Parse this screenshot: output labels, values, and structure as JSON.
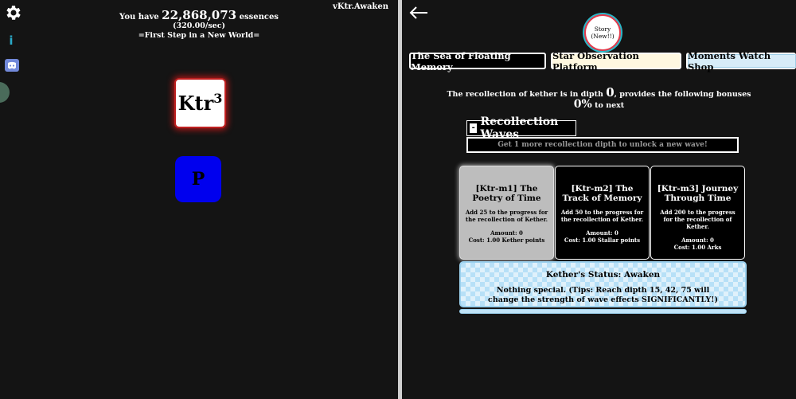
{
  "left": {
    "version": "vKtr.Awaken",
    "essence_prefix": "You have",
    "essence_amount": "22,868,073",
    "essence_suffix": "essences",
    "rate": "(320.00/sec)",
    "world": "=First Step in a New World=",
    "ktr_label": "Ktr",
    "ktr_exponent": "3",
    "p_label": "P",
    "info_glyph": "i",
    "icons": [
      "gear-icon",
      "info-icon",
      "discord-icon"
    ]
  },
  "right": {
    "back_glyph": "←",
    "story": {
      "line1": "Story",
      "line2": "(New!!)"
    },
    "tabs": [
      {
        "label": "The Sea of Floating Memory"
      },
      {
        "label": "Star Observation Platform"
      },
      {
        "label": "Moments Watch Shop"
      }
    ],
    "bonus": {
      "prefix": "The recollection of kether is in dipth",
      "depth": "0",
      "suffix": ", provides the following bonuses",
      "percent": "0%",
      "next": "to next"
    },
    "waves": {
      "collapse": "-",
      "title": "Recollection Waves",
      "unlock_hint": "Get 1 more recollection dipth to unlock a new wave!",
      "cards": [
        {
          "title": "[Ktr-m1] The Poetry of Time",
          "desc": "Add 25 to the progress for the recollection of Kether.",
          "amount": "Amount: 0",
          "cost": "Cost: 1.00 Kether points"
        },
        {
          "title": "[Ktr-m2] The Track of Memory",
          "desc": "Add 50 to the progress for the recollection of Kether.",
          "amount": "Amount: 0",
          "cost": "Cost: 1.00 Stallar points"
        },
        {
          "title": "[Ktr-m3] Journey Through Time",
          "desc": "Add 200 to the progress for the recollection of Kether.",
          "amount": "Amount: 0",
          "cost": "Cost: 1.00 Arks"
        }
      ]
    },
    "status": {
      "title": "Kether's Status: Awaken",
      "tip": "Nothing special. (Tips: Reach dipth 15, 42, 75 will change the strength of wave effects SIGNIFICANTLY!)"
    }
  },
  "colors": {
    "background": "#141414",
    "ktr_glow": "#c02020",
    "p_button": "#0000ee",
    "status_blue": "#b7e0f7",
    "story_ring_red": "#e23a4b",
    "story_ring_teal": "#2ab7c8"
  }
}
